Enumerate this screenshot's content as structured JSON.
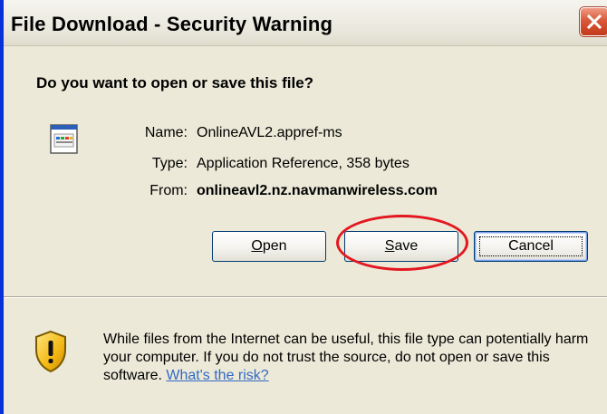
{
  "window": {
    "title": "File Download - Security Warning",
    "close_icon": "close-icon"
  },
  "dialog": {
    "question": "Do you want to open or save this file?",
    "file_icon": "file-icon",
    "fields": {
      "name_label": "Name:",
      "name_value": "OnlineAVL2.appref-ms",
      "type_label": "Type:",
      "type_value": "Application Reference, 358 bytes",
      "from_label": "From:",
      "from_value": "onlineavl2.nz.navmanwireless.com"
    },
    "buttons": {
      "open": "Open",
      "save": "Save",
      "cancel": "Cancel"
    },
    "warning": {
      "icon": "shield-warning-icon",
      "text": "While files from the Internet can be useful, this file type can potentially harm your computer. If you do not trust the source, do not open or save this software.",
      "link": "What's the risk?"
    }
  },
  "colors": {
    "window_border": "#0831d9",
    "dialog_bg": "#ece9d8",
    "highlight": "#e2171f",
    "link": "#316ac5"
  }
}
